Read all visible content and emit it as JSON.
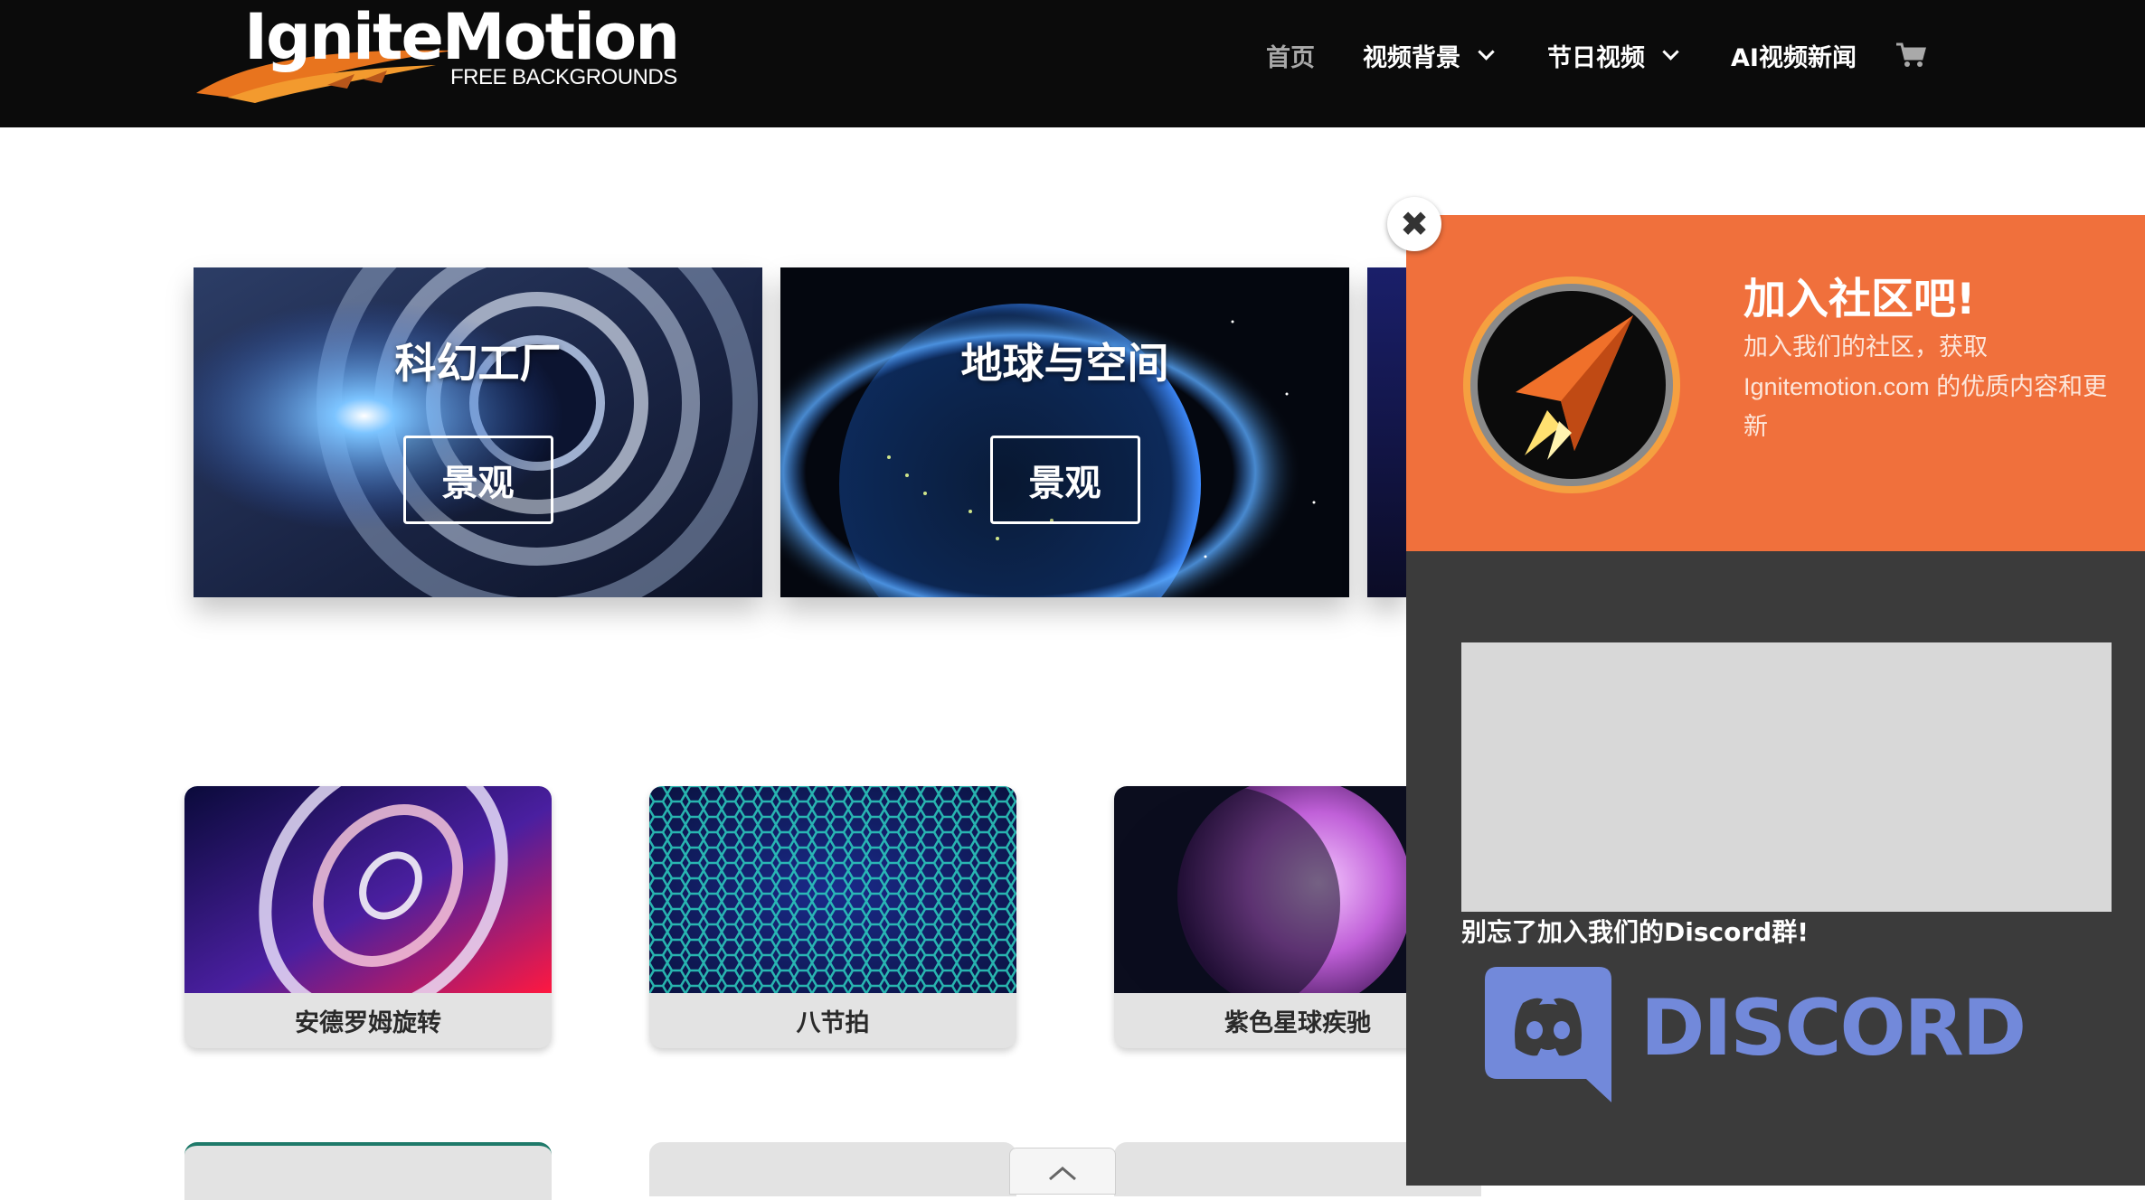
{
  "header": {
    "logo": {
      "wordmark": "IgniteMotion",
      "subtitle": "FREE BACKGROUNDS"
    },
    "nav": [
      {
        "label": "首页",
        "has_dropdown": false,
        "active": true
      },
      {
        "label": "视频背景",
        "has_dropdown": true
      },
      {
        "label": "节日视频",
        "has_dropdown": true
      },
      {
        "label": "AI视频新闻",
        "has_dropdown": false
      }
    ],
    "cart_icon": "shopping-cart-icon"
  },
  "categories": [
    {
      "title": "科幻工厂",
      "button": "景观"
    },
    {
      "title": "地球与空间",
      "button": "景观"
    }
  ],
  "videos": [
    {
      "label": "安德罗姆旋转"
    },
    {
      "label": "八节拍"
    },
    {
      "label": "紫色星球疾驰"
    }
  ],
  "popup": {
    "title": "加入社区吧!",
    "description": "加入我们的社区，获取 Ignitemotion.com 的优质内容和更新",
    "cta": "别忘了加入我们的Discord群!",
    "discord_wordmark": "DISCORD",
    "close_icon": "close-icon"
  },
  "scroll_top_icon": "chevron-up-icon",
  "colors": {
    "header_bg": "#0b0b0b",
    "popup_accent": "#f0703c",
    "popup_bg": "#3b3b3b",
    "discord": "#7289da"
  }
}
